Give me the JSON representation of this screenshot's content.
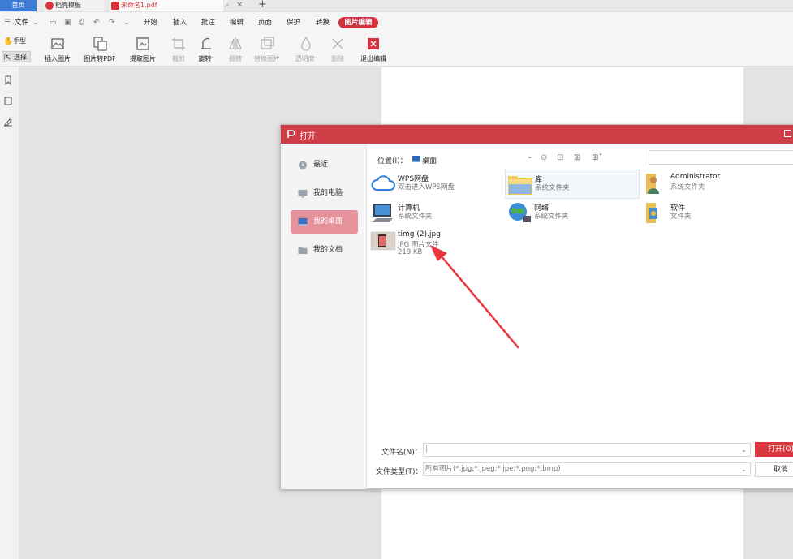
{
  "tabs": {
    "home": "首页",
    "template": "稻壳模板",
    "doc": "未命名1.pdf",
    "new_tab": "+"
  },
  "menu": {
    "file": "文件",
    "items": [
      "开始",
      "插入",
      "批注",
      "编辑",
      "页面",
      "保护",
      "转换"
    ],
    "active": "图片编辑"
  },
  "ribbon": {
    "hand": "手型",
    "select": "选择",
    "insert_image": "插入图片",
    "image_to_pdf": "图片转PDF",
    "extract_image": "提取图片",
    "crop": "裁剪",
    "rotate": "旋转",
    "flip": "翻转",
    "replace_image": "替换图片",
    "transparency": "透明度",
    "delete": "删除",
    "exit_edit": "退出编辑"
  },
  "dialog": {
    "title": "打开",
    "nav": [
      "最近",
      "我的电脑",
      "我的桌面",
      "我的文档"
    ],
    "location_label": "位置(I)：",
    "location_value": "桌面",
    "items": [
      {
        "name": "WPS网盘",
        "desc": "双击进入WPS网盘",
        "icon": "cloud-icon"
      },
      {
        "name": "库",
        "desc": "系统文件夹",
        "icon": "library-folder-icon"
      },
      {
        "name": "Administrator",
        "desc": "系统文件夹",
        "icon": "user-folder-icon"
      },
      {
        "name": "计算机",
        "desc": "系统文件夹",
        "icon": "computer-icon"
      },
      {
        "name": "网络",
        "desc": "系统文件夹",
        "icon": "network-globe-icon"
      },
      {
        "name": "软件",
        "desc": "文件夹",
        "icon": "folder-icon"
      },
      {
        "name": "timg (2).jpg",
        "desc": "JPG 图片文件",
        "size": "219 KB",
        "icon": "image-thumbnail-icon"
      }
    ],
    "filename_label": "文件名(N)：",
    "filename_value": "",
    "filetype_label": "文件类型(T)：",
    "filetype_value": "所有图片(*.jpg;*.jpeg;*.jpe;*.png;*.bmp)",
    "open_button": "打开(O)",
    "cancel_button": "取消"
  },
  "colors": {
    "accent": "#cf3d47",
    "tab_home": "#3c7bd6",
    "nav_active": "#e5929a",
    "annotation_arrow": "#e8343b"
  }
}
